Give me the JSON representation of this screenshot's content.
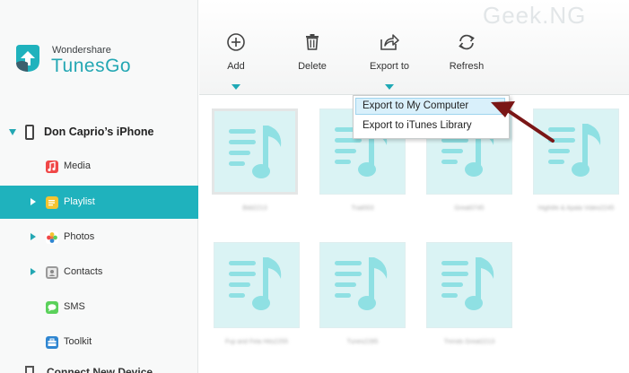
{
  "app": {
    "brand_small": "Wondershare",
    "brand_name": "TunesGo",
    "watermark": "Geek.NG"
  },
  "device": {
    "name": "Don Caprio’s iPhone"
  },
  "sidebar": {
    "items": [
      {
        "label": "Media",
        "icon": "music-note-icon",
        "color": "#f04747",
        "active": false,
        "expandable": false
      },
      {
        "label": "Playlist",
        "icon": "playlist-icon",
        "color": "#f4c430",
        "active": true,
        "expandable": true
      },
      {
        "label": "Photos",
        "icon": "flower-icon",
        "color": "#f07b3c",
        "active": false,
        "expandable": true
      },
      {
        "label": "Contacts",
        "icon": "contacts-icon",
        "color": "#8a8a8a",
        "active": false,
        "expandable": true
      },
      {
        "label": "SMS",
        "icon": "sms-icon",
        "color": "#5bd15b",
        "active": false,
        "expandable": false
      },
      {
        "label": "Toolkit",
        "icon": "toolbox-icon",
        "color": "#2f86d1",
        "active": false,
        "expandable": false
      }
    ],
    "partial_label": "Connect New Device"
  },
  "toolbar": {
    "add": "Add",
    "delete": "Delete",
    "export": "Export to",
    "refresh": "Refresh"
  },
  "export_menu": {
    "items": [
      "Export to My Computer",
      "Export to iTunes Library"
    ]
  },
  "playlists": [
    {
      "name": "Bild2213"
    },
    {
      "name": "Trail003"
    },
    {
      "name": "Great0745"
    },
    {
      "name": "Highlife & Apala Video2245"
    },
    {
      "name": "Fuji and Fela Hits2255"
    },
    {
      "name": "Tunes2285"
    },
    {
      "name": "Trends Great2213"
    }
  ],
  "colors": {
    "accent": "#1fb2bd",
    "thumb_bg": "#daf3f4",
    "note_color": "#8fe0e3",
    "pointer_arrow": "#7a1616"
  }
}
